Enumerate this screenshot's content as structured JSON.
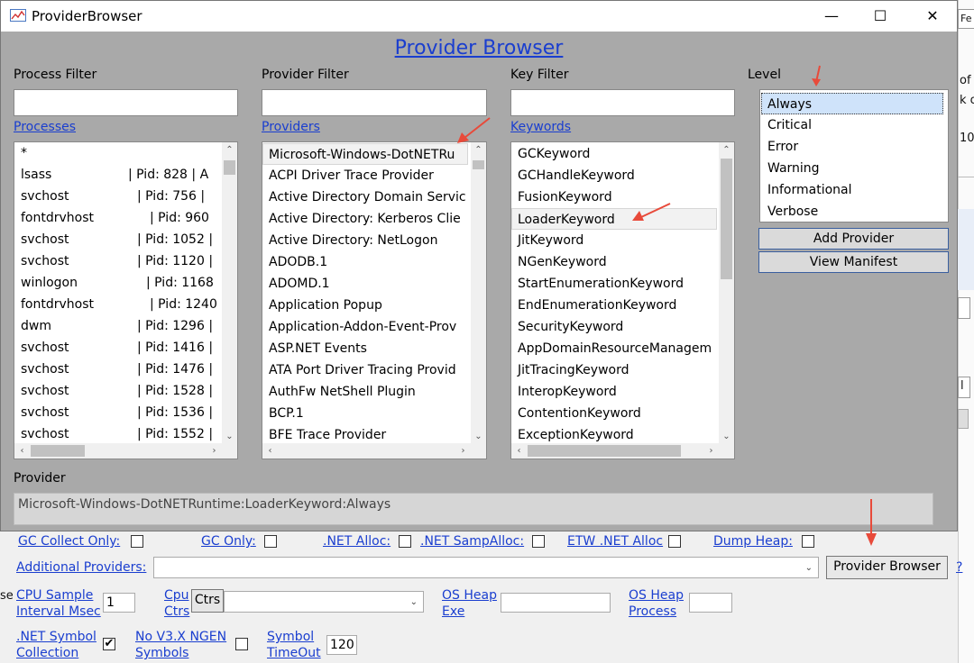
{
  "window": {
    "title": "ProviderBrowser",
    "heading": "Provider Browser",
    "minimize_glyph": "—",
    "maximize_glyph": "☐",
    "close_glyph": "✕"
  },
  "process_filter": {
    "label": "Process Filter",
    "value": "",
    "link": "Processes",
    "items": [
      {
        "name": "*",
        "pid": ""
      },
      {
        "name": "lsass",
        "pid": "| Pid:   828 | A"
      },
      {
        "name": "svchost",
        "pid": "| Pid:   756 |"
      },
      {
        "name": "fontdrvhost",
        "pid": "| Pid:   960"
      },
      {
        "name": "svchost",
        "pid": "| Pid: 1052 |"
      },
      {
        "name": "svchost",
        "pid": "| Pid: 1120 |"
      },
      {
        "name": "winlogon",
        "pid": "| Pid:  1168"
      },
      {
        "name": "fontdrvhost",
        "pid": "| Pid: 1240"
      },
      {
        "name": "dwm",
        "pid": "| Pid: 1296 |"
      },
      {
        "name": "svchost",
        "pid": "| Pid: 1416 |"
      },
      {
        "name": "svchost",
        "pid": "| Pid: 1476 |"
      },
      {
        "name": "svchost",
        "pid": "| Pid: 1528 |"
      },
      {
        "name": "svchost",
        "pid": "| Pid: 1536 |"
      },
      {
        "name": "svchost",
        "pid": "| Pid: 1552 |"
      }
    ]
  },
  "provider_filter": {
    "label": "Provider Filter",
    "value": "",
    "link": "Providers",
    "items": [
      "Microsoft-Windows-DotNETRu",
      "ACPI Driver Trace Provider",
      "Active Directory Domain Servic",
      "Active Directory: Kerberos Clie",
      "Active Directory: NetLogon",
      "ADODB.1",
      "ADOMD.1",
      "Application Popup",
      "Application-Addon-Event-Prov",
      "ASP.NET Events",
      "ATA Port Driver Tracing Provid",
      "AuthFw NetShell Plugin",
      "BCP.1",
      "BFE Trace Provider"
    ]
  },
  "key_filter": {
    "label": "Key Filter",
    "value": "",
    "link": "Keywords",
    "items": [
      "GCKeyword",
      "GCHandleKeyword",
      "FusionKeyword",
      "LoaderKeyword",
      "JitKeyword",
      "NGenKeyword",
      "StartEnumerationKeyword",
      "EndEnumerationKeyword",
      "SecurityKeyword",
      "AppDomainResourceManagem",
      "JitTracingKeyword",
      "InteropKeyword",
      "ContentionKeyword",
      "ExceptionKeyword"
    ]
  },
  "level": {
    "label": "Level",
    "items": [
      "Always",
      "Critical",
      "Error",
      "Warning",
      "Informational",
      "Verbose"
    ],
    "add_button": "Add Provider",
    "view_button": "View Manifest"
  },
  "provider": {
    "label": "Provider",
    "value": "Microsoft-Windows-DotNETRuntime:LoaderKeyword:Always"
  },
  "options": {
    "gc_collect_only": "GC Collect Only:",
    "gc_only": "GC Only:",
    "net_alloc": ".NET Alloc:",
    "net_samp_alloc": ".NET SampAlloc:",
    "etw_net_alloc": "ETW .NET Alloc",
    "dump_heap": "Dump Heap:",
    "additional_providers": "Additional Providers:",
    "additional_providers_value": "",
    "provider_browser_button": "Provider Browser",
    "help_link": "?",
    "cpu_sample_line1": "CPU Sample",
    "cpu_sample_line2": "Interval Msec",
    "cpu_sample_value": "1",
    "cpu_ctrs_line1": "Cpu",
    "cpu_ctrs_line2": "Ctrs",
    "ctrs_button": "Ctrs",
    "os_heap_exe_line1": "OS Heap",
    "os_heap_exe_line2": "Exe",
    "os_heap_process_line1": "OS Heap",
    "os_heap_process_line2": "Process",
    "net_symbol_line1": ".NET Symbol",
    "net_symbol_line2": "Collection",
    "net_symbol_check": "✔",
    "no_v3x_line1": "No V3.X NGEN",
    "no_v3x_line2": "Symbols",
    "symbol_timeout_line1": "Symbol",
    "symbol_timeout_line2": "TimeOut",
    "symbol_timeout_value": "120",
    "left_edge_fragment": "se"
  },
  "background_fragments": {
    "top_right": "Fe",
    "line1": "of",
    "line2": "k o",
    "line3": "10-",
    "mark1": "l"
  }
}
